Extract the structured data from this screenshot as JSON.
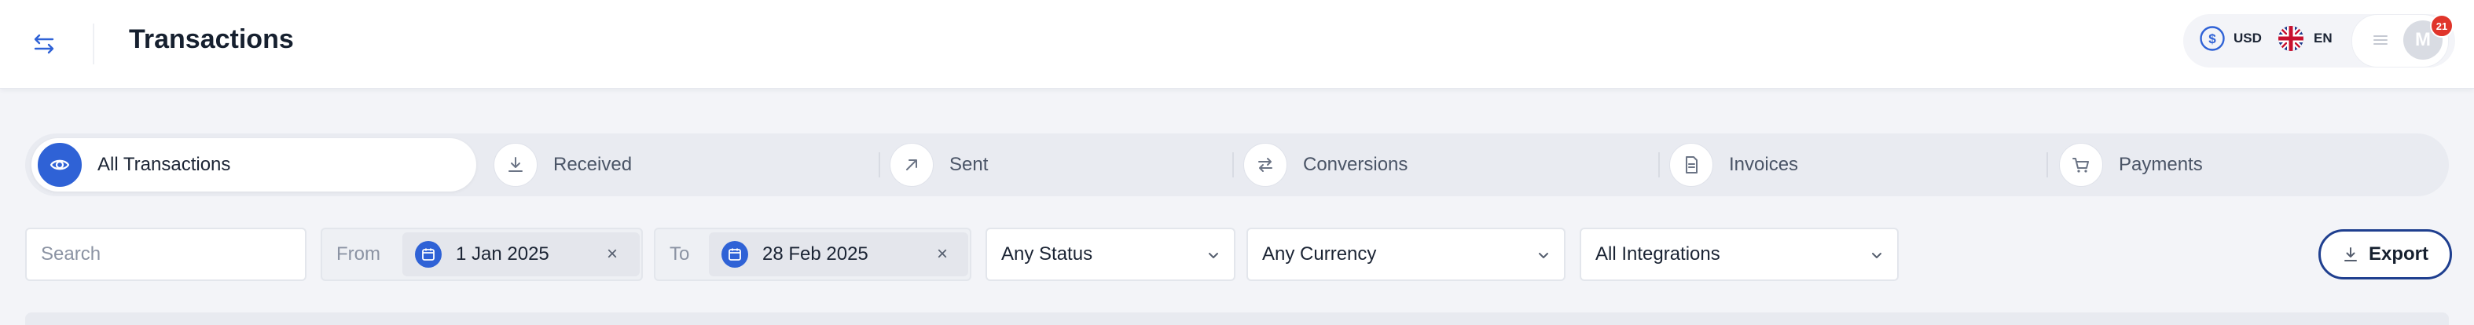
{
  "header": {
    "title": "Transactions",
    "menu_icon": "swap-arrows-icon",
    "currency": {
      "symbol": "$",
      "code": "USD"
    },
    "language": {
      "code": "EN",
      "flag": "uk-flag-icon"
    },
    "avatar_initial": "M",
    "notification_count": "21"
  },
  "tabs": [
    {
      "label": "All Transactions",
      "icon": "eye-icon",
      "active": true
    },
    {
      "label": "Received",
      "icon": "download-icon",
      "active": false
    },
    {
      "label": "Sent",
      "icon": "arrow-up-right-icon",
      "active": false
    },
    {
      "label": "Conversions",
      "icon": "exchange-icon",
      "active": false
    },
    {
      "label": "Invoices",
      "icon": "document-icon",
      "active": false
    },
    {
      "label": "Payments",
      "icon": "cart-icon",
      "active": false
    }
  ],
  "filters": {
    "search_placeholder": "Search",
    "from_label": "From",
    "from_value": "1 Jan 2025",
    "to_label": "To",
    "to_value": "28 Feb 2025",
    "status": "Any Status",
    "currency": "Any Currency",
    "integrations": "All Integrations"
  },
  "export_label": "Export",
  "colors": {
    "accent": "#2f62d6",
    "export_border": "#1f3f8f",
    "badge": "#e0352b",
    "background": "#f3f4f8"
  }
}
